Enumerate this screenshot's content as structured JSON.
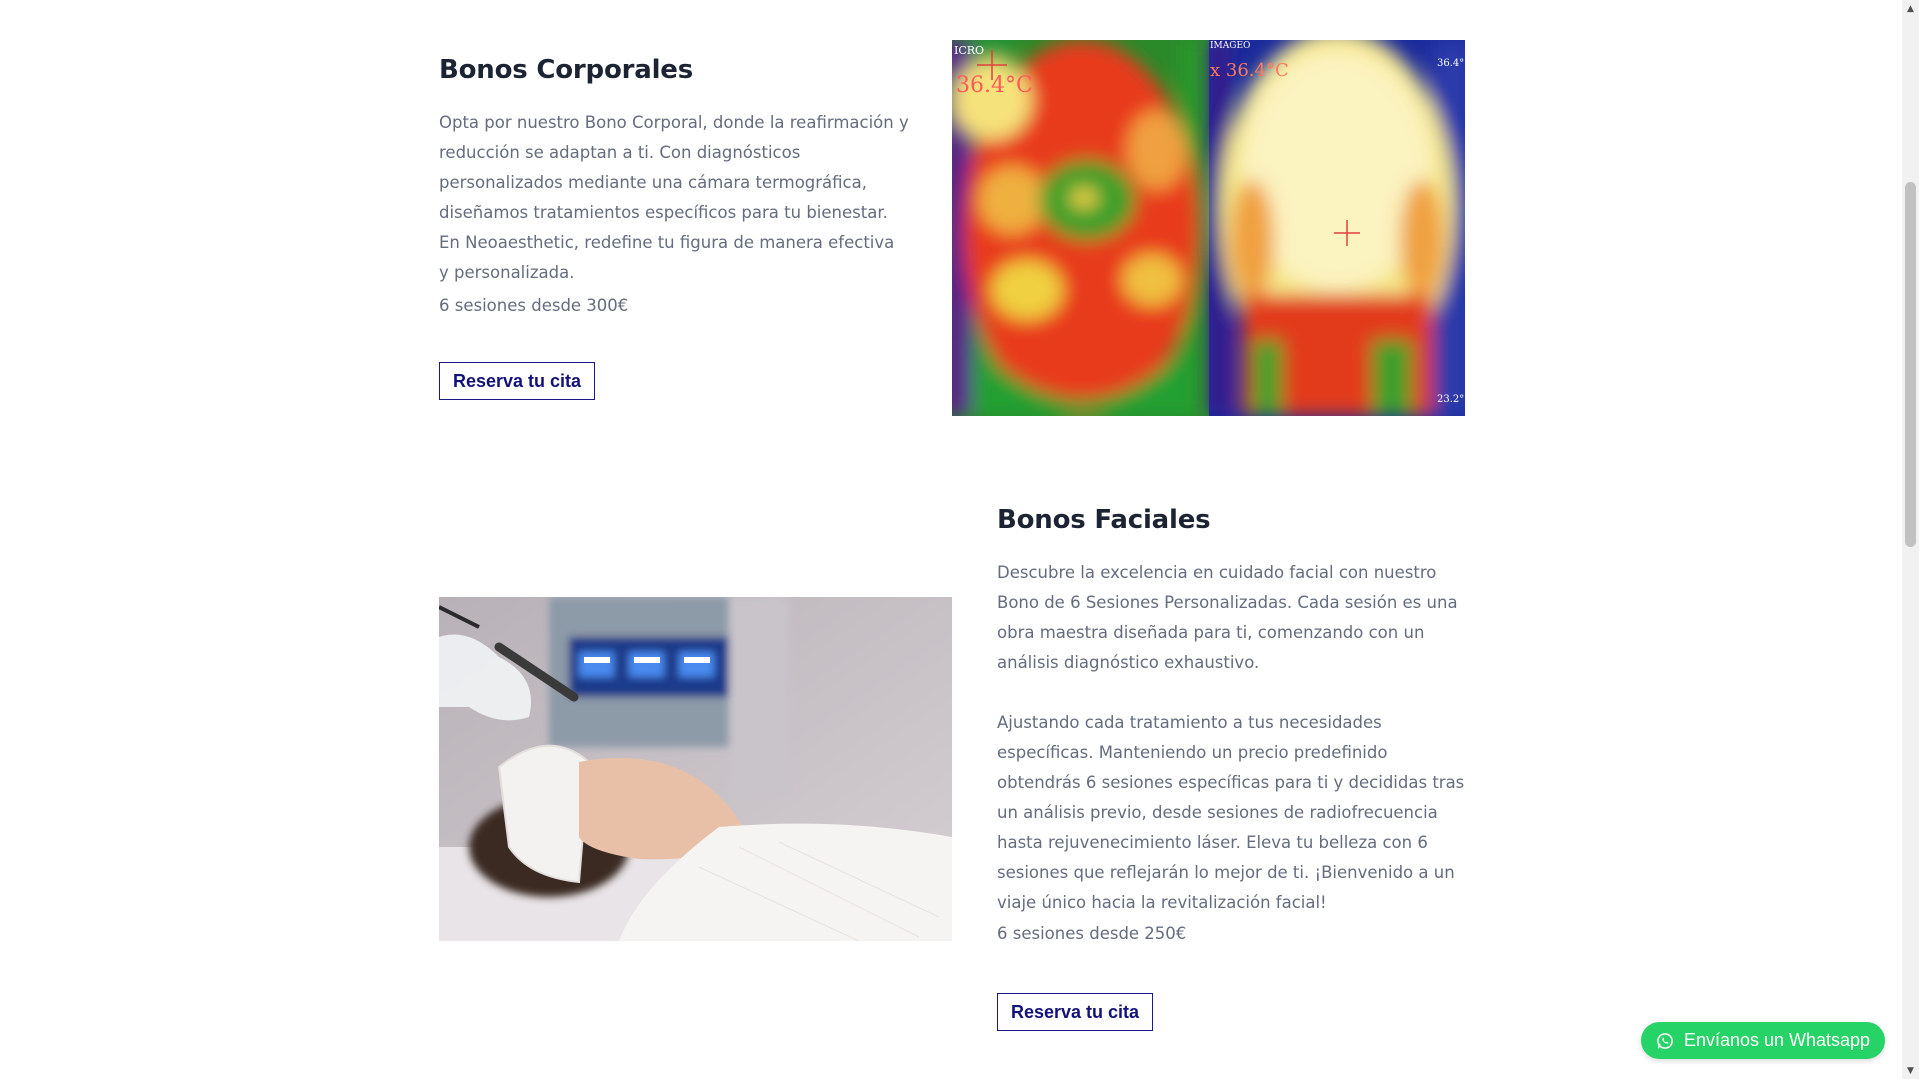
{
  "corporales": {
    "title": "Bonos Corporales",
    "description": "Opta por nuestro Bono Corporal, donde la reafirmación y reducción se adaptan a ti. Con diagnósticos personalizados mediante una cámara termográfica, diseñamos tratamientos específicos para tu bienestar. En Neoaesthetic, redefine tu figura de manera efectiva y personalizada.",
    "price": "6 sesiones desde 300€",
    "cta_label": "Reserva tu cita",
    "image": {
      "temp_left": "36.4°C",
      "temp_right": "x 36.4°C",
      "label_left": "ICRO",
      "label_right": "IMAGEO",
      "corner_top": "36.4°",
      "corner_bottom": "23.2°"
    }
  },
  "faciales": {
    "title": "Bonos Faciales",
    "description_1": "Descubre la excelencia en cuidado facial con nuestro Bono de 6 Sesiones Personalizadas. Cada sesión es una obra maestra diseñada para ti, comenzando con un análisis diagnóstico exhaustivo.",
    "description_2": "Ajustando cada tratamiento a tus necesidades específicas. Manteniendo un precio predefinido obtendrás 6 sesiones específicas para ti y decididas tras un análisis previo, desde sesiones de radiofrecuencia hasta rejuvenecimiento láser. Eleva tu belleza con 6 sesiones que reflejarán lo mejor de ti. ¡Bienvenido a un viaje único hacia la revitalización facial!",
    "price": "6 sesiones desde 250€",
    "cta_label": "Reserva tu cita"
  },
  "whatsapp": {
    "label": "Envíanos un Whatsapp",
    "color": "#25d366"
  },
  "scrollbar": {
    "up_icon": "▲",
    "down_icon": "▼"
  }
}
